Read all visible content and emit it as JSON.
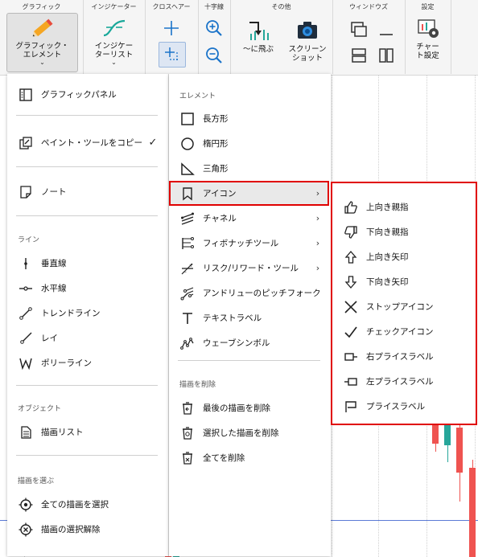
{
  "ribbon": {
    "groups": {
      "graphic": "グラフィック",
      "indicator": "インジケーター",
      "crosshair": "クロスヘアー",
      "crossline": "十字線",
      "other": "その他",
      "window": "ウィンドウズ",
      "settings": "設定"
    },
    "graphic_elements_line1": "グラフィック・",
    "graphic_elements_line2": "エレメント",
    "indicator_list_line1": "インジケー",
    "indicator_list_line2": "ターリスト",
    "jump_to": "～に飛ぶ",
    "screenshot_line1": "スクリーン",
    "screenshot_line2": "ショット",
    "chart_settings_line1": "チャー",
    "chart_settings_line2": "ト設定"
  },
  "menu1": {
    "graphic_panel": "グラフィックパネル",
    "copy_paint_tool": "ペイント・ツールをコピー",
    "copy_checked": "✓",
    "note": "ノート",
    "line_section": "ライン",
    "vertical_line": "垂直線",
    "horizontal_line": "水平線",
    "trend_line": "トレンドライン",
    "ray": "レイ",
    "polyline": "ポリーライン",
    "object_section": "オブジェクト",
    "drawing_list": "描画リスト",
    "select_section": "描画を選ぶ",
    "select_all": "全ての描画を選択",
    "deselect": "描画の選択解除"
  },
  "menu2": {
    "element_section": "エレメント",
    "rectangle": "長方形",
    "ellipse": "楕円形",
    "triangle": "三角形",
    "icon": "アイコン",
    "channel": "チャネル",
    "fibonacci": "フィボナッチツール",
    "risk_reward": "リスク/リワード・ツール",
    "andrews_pitchfork": "アンドリューのピッチフォーク",
    "text_label": "テキストラベル",
    "wave_symbol": "ウェーブシンボル",
    "delete_section": "描画を削除",
    "delete_last": "最後の描画を削除",
    "delete_selected": "選択した描画を削除",
    "delete_all": "全てを削除",
    "submenu_arrow": "›"
  },
  "menu3": {
    "thumbs_up": "上向き親指",
    "thumbs_down": "下向き親指",
    "arrow_up": "上向き矢印",
    "arrow_down": "下向き矢印",
    "stop_icon": "ストップアイコン",
    "check_icon": "チェックアイコン",
    "right_price_label": "右プライスラベル",
    "left_price_label": "左プライスラベル",
    "price_label": "プライスラベル"
  },
  "colors": {
    "highlight_border": "#e00000",
    "bear_candle": "#ef5350",
    "bull_candle": "#26a69a",
    "price_line": "#5b7bd6"
  }
}
